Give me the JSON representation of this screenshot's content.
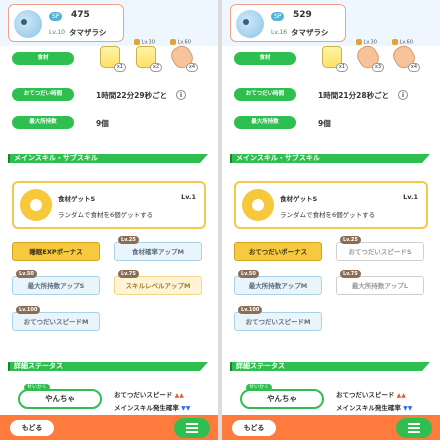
{
  "panels": [
    {
      "sp_tag": "SP",
      "sp_value": "475",
      "level": "Lv.10",
      "name": "タマザラシ",
      "ingredient_label": "食材",
      "ingredients": [
        {
          "lock": "",
          "count": "x1",
          "type": "bottle"
        },
        {
          "lock": "Lv.30",
          "count": "x2",
          "type": "bottle"
        },
        {
          "lock": "Lv.60",
          "count": "x4",
          "type": "potato"
        }
      ],
      "help_label": "おてつだい時間",
      "help_time": "1時間22分29秒ごと",
      "max_label": "最大所持数",
      "max_value": "9個",
      "skills_title": "メインスキル・サブスキル",
      "main_skill": {
        "name": "食材ゲットS",
        "lv": "Lv.1",
        "desc": "ランダムで食材を6個ゲットする"
      },
      "sub_skills": [
        {
          "badge": "",
          "label": "睡眠EXPボーナス",
          "style": "gold"
        },
        {
          "badge": "Lv.25",
          "label": "食材確率アップM",
          "style": "blue"
        },
        {
          "badge": "Lv.50",
          "label": "最大所持数アップS",
          "style": "blue"
        },
        {
          "badge": "Lv.75",
          "label": "スキルレベルアップM",
          "style": "yellow"
        },
        {
          "badge": "Lv.100",
          "label": "おてつだいスピードM",
          "style": "blue"
        }
      ],
      "detail_title": "詳細ステータス",
      "nature_tag": "せいかく",
      "nature": "やんちゃ",
      "stat_up": "おてつだいスピード",
      "stat_down": "メインスキル発生確率",
      "back": "もどる"
    },
    {
      "sp_tag": "SP",
      "sp_value": "529",
      "level": "Lv.16",
      "name": "タマザラシ",
      "ingredient_label": "食材",
      "ingredients": [
        {
          "lock": "",
          "count": "x1",
          "type": "bottle"
        },
        {
          "lock": "Lv.30",
          "count": "x3",
          "type": "potato"
        },
        {
          "lock": "Lv.60",
          "count": "x4",
          "type": "potato"
        }
      ],
      "help_label": "おてつだい時間",
      "help_time": "1時間21分28秒ごと",
      "max_label": "最大所持数",
      "max_value": "9個",
      "skills_title": "メインスキル・サブスキル",
      "main_skill": {
        "name": "食材ゲットS",
        "lv": "Lv.1",
        "desc": "ランダムで食材を6個ゲットする"
      },
      "sub_skills": [
        {
          "badge": "",
          "label": "おてつだいボーナス",
          "style": "gold"
        },
        {
          "badge": "Lv.25",
          "label": "おてつだいスピードS",
          "style": "empty"
        },
        {
          "badge": "Lv.50",
          "label": "最大所持数アップM",
          "style": "blue"
        },
        {
          "badge": "Lv.75",
          "label": "最大所持数アップL",
          "style": "empty"
        },
        {
          "badge": "Lv.100",
          "label": "おてつだいスピードM",
          "style": "blue"
        }
      ],
      "detail_title": "詳細ステータス",
      "nature_tag": "せいかく",
      "nature": "やんちゃ",
      "stat_up": "おてつだいスピード",
      "stat_down": "メインスキル発生確率",
      "back": "もどる"
    }
  ],
  "colors": {
    "accent": "#2fbf50",
    "footer": "#ff7a3d",
    "card_border": "#f3a08a",
    "gold": "#f6c93f"
  }
}
